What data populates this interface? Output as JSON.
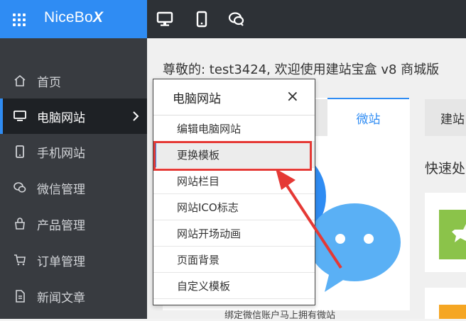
{
  "header": {
    "logo_text": "NiceBo",
    "logo_x": "X",
    "icons": [
      "desktop-icon",
      "mobile-icon",
      "chat-icon"
    ]
  },
  "sidebar": {
    "items": [
      {
        "label": "首页",
        "icon": "home-icon"
      },
      {
        "label": "电脑网站",
        "icon": "desktop-icon",
        "active": true
      },
      {
        "label": "手机网站",
        "icon": "mobile-icon"
      },
      {
        "label": "微信管理",
        "icon": "wechat-icon"
      },
      {
        "label": "产品管理",
        "icon": "bag-icon"
      },
      {
        "label": "订单管理",
        "icon": "cart-icon"
      },
      {
        "label": "新闻文章",
        "icon": "article-icon"
      }
    ]
  },
  "main": {
    "welcome": "尊敬的: test3424, 欢迎使用建站宝盒 v8 商城版",
    "tabs": [
      {
        "label": "微站"
      },
      {
        "label": "建站"
      }
    ],
    "quick_title": "快速处",
    "bind_caption": "绑定微信账户马上拥有微站"
  },
  "popup_menu": {
    "title": "电脑网站",
    "close": "×",
    "items": [
      {
        "label": "编辑电脑网站"
      },
      {
        "label": "更换模板",
        "highlighted": true
      },
      {
        "label": "网站栏目"
      },
      {
        "label": "网站ICO标志"
      },
      {
        "label": "网站开场动画"
      },
      {
        "label": "页面背景"
      },
      {
        "label": "自定义模板"
      }
    ]
  },
  "colors": {
    "accent": "#2f8cf3",
    "annotation_red": "#e53935"
  }
}
